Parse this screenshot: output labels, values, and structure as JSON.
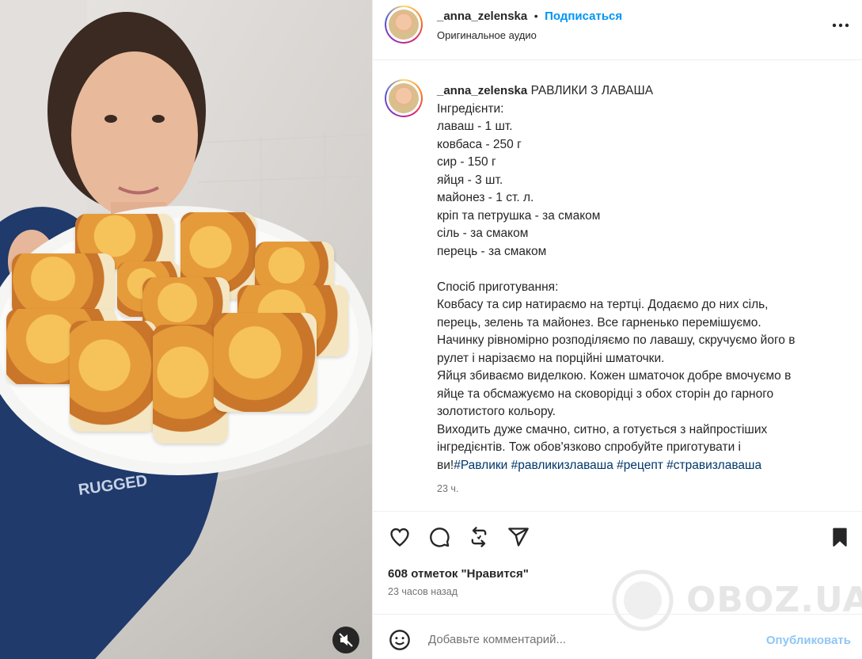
{
  "post": {
    "username": "_anna_zelenska",
    "follow_label": "Подписаться",
    "separator": "•",
    "audio": "Оригинальное аудио",
    "caption_title": "РАВЛИКИ З ЛАВАША",
    "caption_body": "Інгредієнти:\nлаваш - 1 шт.\nковбаса - 250 г\nсир - 150 г\nяйця - 3 шт.\nмайонез - 1 ст. л.\nкріп та петрушка - за смаком\nсіль - за смаком\nперець - за смаком\n\nСпосіб приготування:\nКовбасу та сир натираємо на тертці. Додаємо до них сіль,\nперець, зелень та майонез. Все гарненько перемішуємо.\nНачинку рівномірно розподіляємо по лавашу, скручуємо його в\nрулет і нарізаємо на порційні шматочки.\nЯйця збиваємо виделкою. Кожен шматочок добре вмочуємо в\nяйце та обсмажуємо на сковорідці з обох сторін до гарного\nзолотистого кольору.\nВиходить дуже смачно, ситно, а готується з найпростіших\nінгредієнтів. Тож обов'язково спробуйте приготувати і\nви!",
    "hashtags": [
      "#Равлики",
      "#равликизлаваша",
      "#рецепт",
      "#стравизлаваша"
    ],
    "caption_time": "23 ч.",
    "likes": "608 отметок \"Нравится\"",
    "posted_ago": "23 часов назад"
  },
  "comment": {
    "placeholder": "Добавьте комментарий...",
    "publish_label": "Опубликовать"
  },
  "watermark": "OBOZ.UA",
  "icons": {
    "more": "more-options-icon",
    "like": "heart-icon",
    "comment": "comment-icon",
    "share": "repost-icon",
    "send": "send-icon",
    "save": "bookmark-icon",
    "emoji": "emoji-icon",
    "mute": "muted-speaker-icon"
  },
  "colors": {
    "link": "#0095f6",
    "hashtag": "#00376b",
    "muted_text": "#737373"
  }
}
